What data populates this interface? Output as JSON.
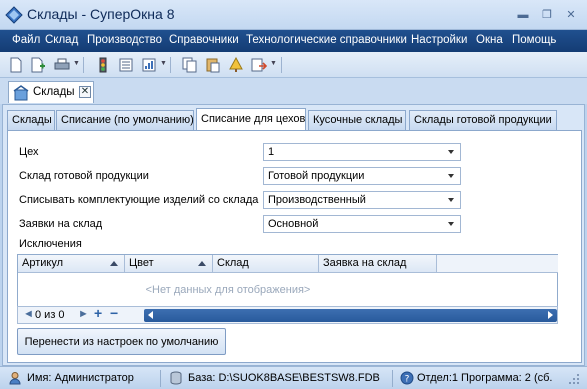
{
  "window": {
    "title": "Склады - СуперОкна 8",
    "min_glyph": "▬",
    "max_glyph": "❐",
    "close_glyph": "✕"
  },
  "menu": {
    "items": [
      "Файл",
      "Склад",
      "Производство",
      "Справочники",
      "Технологические справочники",
      "Настройки",
      "Окна",
      "Помощь"
    ]
  },
  "doc_tab": {
    "label": "Склады",
    "close_glyph": "✕"
  },
  "page_tabs": [
    "Склады",
    "Списание (по умолчанию)",
    "Списание для цехов",
    "Кусочные склады",
    "Склады готовой продукции"
  ],
  "form": {
    "fields": [
      {
        "label": "Цех",
        "value": "1"
      },
      {
        "label": "Склад готовой продукции",
        "value": "Готовой продукции"
      },
      {
        "label": "Списывать комплектующие изделий со склада",
        "value": "Производственный"
      },
      {
        "label": "Заявки на склад",
        "value": "Основной"
      }
    ]
  },
  "exceptions": {
    "label": "Исключения",
    "columns": [
      "Артикул",
      "Цвет",
      "Склад",
      "Заявка на склад"
    ],
    "empty_text": "<Нет данных для отображения>",
    "nav": {
      "prev_glyph": "◄",
      "text": "0 из 0",
      "next_glyph": "►",
      "add_glyph": "+",
      "remove_glyph": "−"
    }
  },
  "transfer_button": "Перенести из настроек по умолчанию",
  "status": {
    "user": "Имя: Администратор",
    "base": "База: D:\\SUOK8BASE\\BESTSW8.FDB",
    "dept": "Отдел:1 Программа: 2 (сб."
  },
  "colors": {
    "menubar": "#1b4785",
    "accent": "#2d62a6",
    "panel": "#ffffff",
    "background": "#bcd3ee"
  }
}
